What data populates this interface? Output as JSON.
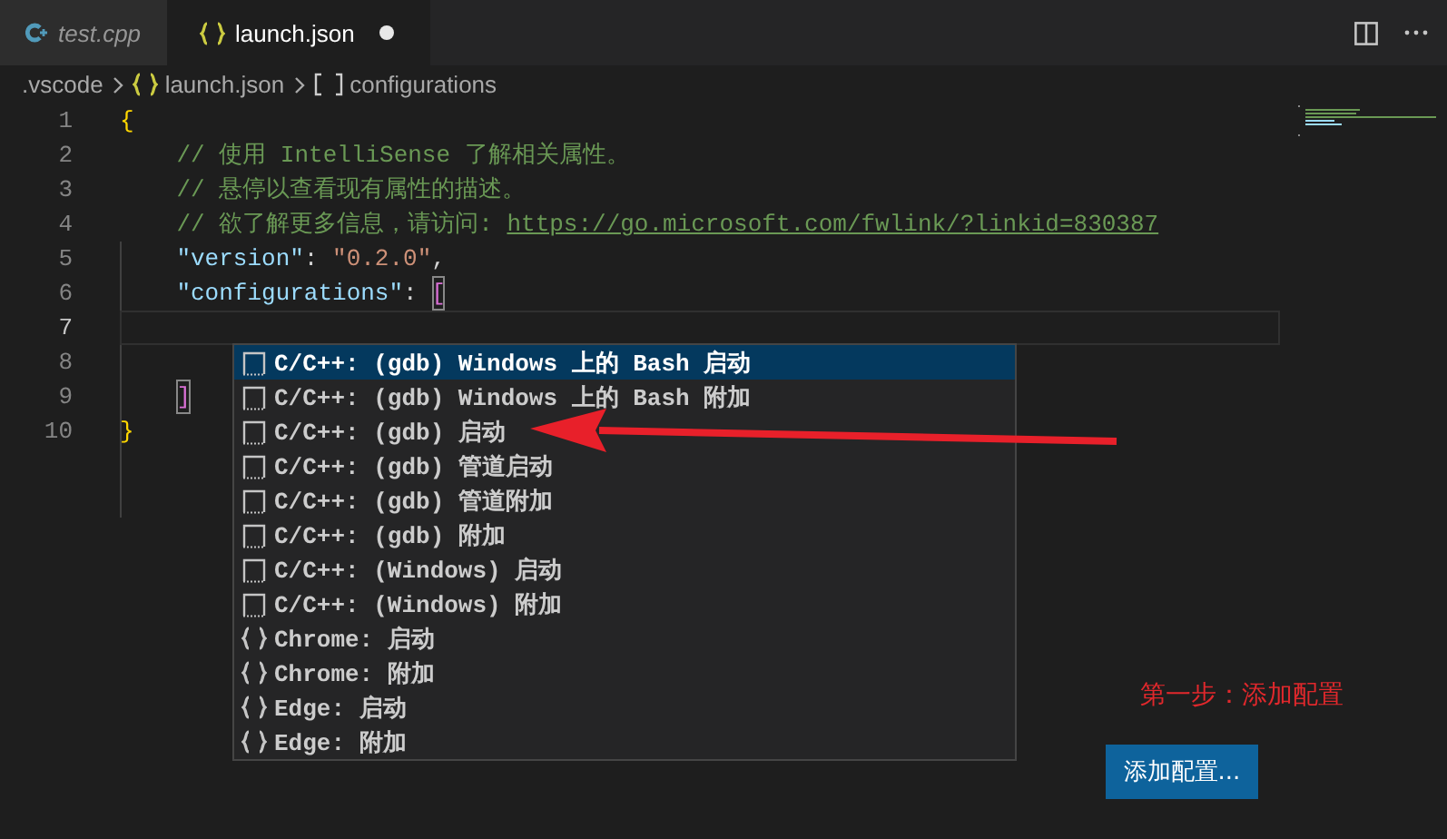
{
  "tabs": [
    {
      "label": "test.cpp",
      "kind": "cpp",
      "selected": false,
      "preview": true,
      "modified": false
    },
    {
      "label": "launch.json",
      "kind": "json",
      "selected": true,
      "preview": false,
      "modified": true
    }
  ],
  "breadcrumb": [
    {
      "label": ".vscode",
      "kind": "folder"
    },
    {
      "label": "launch.json",
      "kind": "json"
    },
    {
      "label": "configurations",
      "kind": "array"
    }
  ],
  "editor": {
    "lines": [
      {
        "number": "1",
        "current": false,
        "segments": [
          {
            "kind": "brace",
            "text": "{"
          }
        ]
      },
      {
        "number": "2",
        "current": false,
        "segments": [
          {
            "kind": "comment",
            "text": "    // 使用 IntelliSense 了解相关属性。"
          }
        ]
      },
      {
        "number": "3",
        "current": false,
        "segments": [
          {
            "kind": "comment",
            "text": "    // 悬停以查看现有属性的描述。"
          }
        ]
      },
      {
        "number": "4",
        "current": false,
        "segments": [
          {
            "kind": "comment",
            "text": "    // 欲了解更多信息，请访问: "
          },
          {
            "kind": "link",
            "text": "https://go.microsoft.com/fwlink/?linkid=830387"
          }
        ]
      },
      {
        "number": "5",
        "current": false,
        "segments": [
          {
            "kind": "key",
            "text": "    \"version\""
          },
          {
            "kind": "punct",
            "text": ": "
          },
          {
            "kind": "string",
            "text": "\"0.2.0\""
          },
          {
            "kind": "punct",
            "text": ","
          }
        ]
      },
      {
        "number": "6",
        "current": false,
        "segments": [
          {
            "kind": "key",
            "text": "    \"configurations\""
          },
          {
            "kind": "punct",
            "text": ": "
          },
          {
            "kind": "bracket-match",
            "text": "["
          }
        ]
      },
      {
        "number": "7",
        "current": true
      },
      {
        "number": "8",
        "current": false
      },
      {
        "number": "9",
        "current": false,
        "segments": [
          {
            "kind": "bracket-match",
            "text": "    ]"
          }
        ]
      },
      {
        "number": "10",
        "current": false,
        "segments": [
          {
            "kind": "brace",
            "text": "}"
          }
        ]
      }
    ]
  },
  "suggestions": [
    {
      "kind": "snippet",
      "label": "C/C++: (gdb) Windows 上的 Bash 启动",
      "selected": true
    },
    {
      "kind": "snippet",
      "label": "C/C++: (gdb) Windows 上的 Bash 附加",
      "selected": false
    },
    {
      "kind": "snippet",
      "label": "C/C++: (gdb) 启动",
      "selected": false
    },
    {
      "kind": "snippet",
      "label": "C/C++: (gdb) 管道启动",
      "selected": false
    },
    {
      "kind": "snippet",
      "label": "C/C++: (gdb) 管道附加",
      "selected": false
    },
    {
      "kind": "snippet",
      "label": "C/C++: (gdb) 附加",
      "selected": false
    },
    {
      "kind": "snippet",
      "label": "C/C++: (Windows) 启动",
      "selected": false
    },
    {
      "kind": "snippet",
      "label": "C/C++: (Windows) 附加",
      "selected": false
    },
    {
      "kind": "module",
      "label": "Chrome: 启动",
      "selected": false
    },
    {
      "kind": "module",
      "label": "Chrome: 附加",
      "selected": false
    },
    {
      "kind": "module",
      "label": "Edge: 启动",
      "selected": false
    },
    {
      "kind": "module",
      "label": "Edge: 附加",
      "selected": false
    }
  ],
  "annotation": {
    "text": "第一步：添加配置",
    "color": "#e0282c"
  },
  "add_button": {
    "label": "添加配置..."
  }
}
